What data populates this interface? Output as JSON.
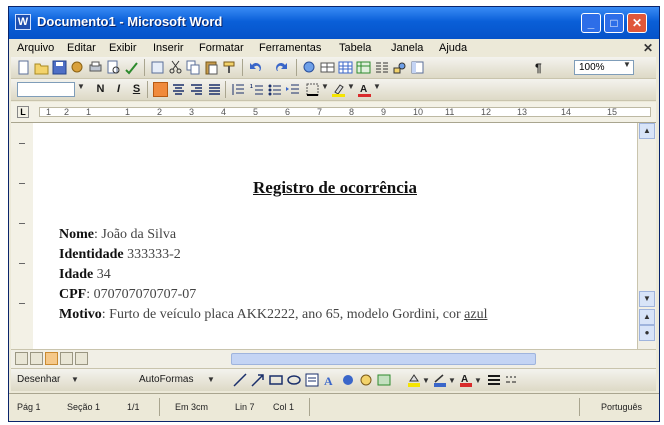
{
  "window": {
    "title": "Documento1 - Microsoft Word",
    "controls": [
      "_",
      "□",
      "✕"
    ]
  },
  "menu": {
    "items": [
      "Arquivo",
      "Editar",
      "Exibir",
      "Inserir",
      "Formatar",
      "Ferramentas",
      "Tabela",
      "Janela",
      "Ajuda"
    ],
    "doc_close": "✕"
  },
  "toolbar_standard": {
    "zoom": "100%"
  },
  "toolbar_format": {
    "bold": "N",
    "italic": "I",
    "underline": "S"
  },
  "ruler": {
    "numbers": [
      "1",
      "2",
      "1",
      "1",
      "2",
      "3",
      "4",
      "5",
      "6",
      "7",
      "8",
      "9",
      "10",
      "11",
      "12",
      "13",
      "14",
      "15"
    ]
  },
  "document": {
    "title": "Registro de ocorrência",
    "fields": [
      {
        "label": "Nome",
        "value": ": João da Silva"
      },
      {
        "label": "Identidade",
        "value": " 333333-2"
      },
      {
        "label": "Idade",
        "value": " 34"
      },
      {
        "label": "CPF",
        "value": ": 070707070707-07"
      },
      {
        "label": "Motivo",
        "value": ": Furto de veículo placa AKK2222, ano 65, modelo Gordini, cor ",
        "tail": "azul"
      }
    ]
  },
  "drawing": {
    "menu_label": "Desenhar",
    "autoshapes_label": "AutoFormas"
  },
  "status": {
    "page": "Pág 1",
    "section": "Seção 1",
    "page_count": "1/1",
    "position": "Em 3cm",
    "line": "Lin 7",
    "column": "Col 1",
    "language": "Português"
  },
  "colors": {
    "title_bar": "#0a5fd8",
    "highlight": "#f5c889",
    "close_button": "#e0583a"
  }
}
